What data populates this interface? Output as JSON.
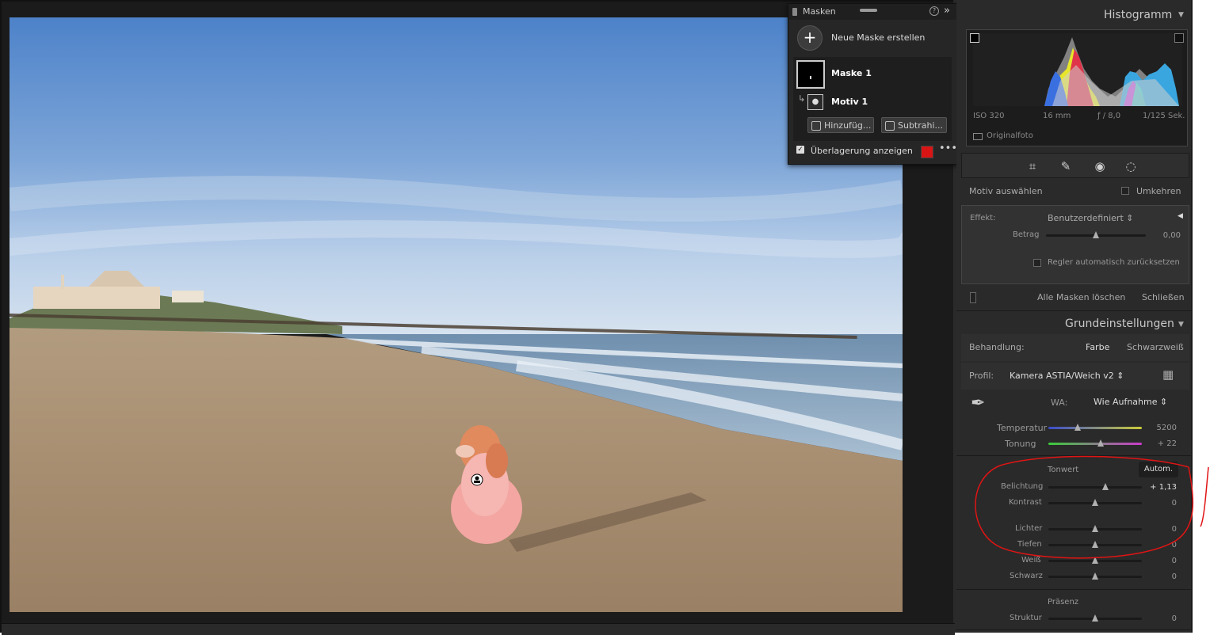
{
  "masks": {
    "title": "Masken",
    "new_mask_label": "Neue Maske erstellen",
    "mask_name": "Maske 1",
    "component_name": "Motiv 1",
    "add_label": "Hinzufüg...",
    "subtract_label": "Subtrahi...",
    "overlay_label": "Überlagerung anzeigen",
    "overlay_checked": true,
    "overlay_color": "#d81414"
  },
  "histogram": {
    "title": "Histogramm",
    "iso": "ISO 320",
    "focal": "16 mm",
    "aperture": "ƒ / 8,0",
    "shutter": "1/125 Sek.",
    "original_label": "Originalfoto"
  },
  "tools": [
    "crop-icon",
    "healing-icon",
    "redeye-icon",
    "masking-icon"
  ],
  "mask_settings": {
    "select_subject": "Motiv auswählen",
    "invert": "Umkehren",
    "effect_label": "Effekt:",
    "effect_value": "Benutzerdefiniert",
    "amount_label": "Betrag",
    "amount_value": "0,00",
    "amount_level": 0.5,
    "auto_reset": "Regler automatisch zurücksetzen",
    "delete_all": "Alle Masken löschen",
    "close": "Schließen"
  },
  "basic": {
    "title": "Grundeinstellungen",
    "treatment_label": "Behandlung:",
    "color_label": "Farbe",
    "bw_label": "Schwarzweiß",
    "profile_label": "Profil:",
    "profile_value": "Kamera ASTIA/Weich v2",
    "wb_label": "WA:",
    "wb_value": "Wie Aufnahme",
    "temp_label": "Temperatur",
    "temp_value": "5200",
    "temp_level": 0.31,
    "tint_label": "Tonung",
    "tint_value": "+ 22",
    "tint_level": 0.56,
    "tone_label": "Tonwert",
    "auto_label": "Autom.",
    "exposure_label": "Belichtung",
    "exposure_value": "+ 1,13",
    "exposure_level": 0.61,
    "contrast_label": "Kontrast",
    "contrast_value": "0",
    "highlights_label": "Lichter",
    "highlights_value": "0",
    "shadows_label": "Tiefen",
    "shadows_value": "0",
    "whites_label": "Weiß",
    "whites_value": "0",
    "blacks_label": "Schwarz",
    "blacks_value": "0",
    "presence_label": "Präsenz",
    "texture_label": "Struktur",
    "texture_value": "0"
  }
}
